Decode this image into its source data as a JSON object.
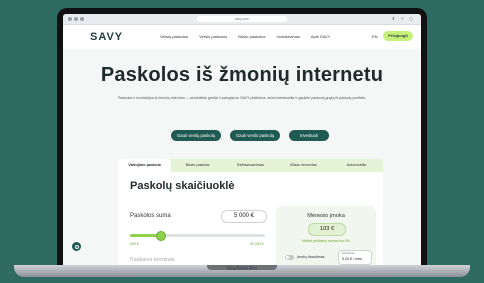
{
  "browser": {
    "url": "savy.com"
  },
  "nav": {
    "logo": "SAVY",
    "links": [
      "Verslų paskolos",
      "Verslo paskolos",
      "Būsto paskolos",
      "Investavimas",
      "Apie SAVY"
    ],
    "lang": "EN",
    "signin": "Prisijungti"
  },
  "hero": {
    "title": "Paskolos iš žmonių internetu",
    "subtitle": "Paskolos ir investicijos iš žmonių internetu — skolinkitės greitai ir patogiai su SAVY platforma, arba investuokite ir gaukite pastovią grąžą iš paskolų portfelio."
  },
  "cta": [
    "Gauti verslų paskolą",
    "Gauti verslo paskolą",
    "Investuoti"
  ],
  "tabs": [
    "Vartojimo paskola",
    "Būsto paskola",
    "Refinansavimas",
    "Būsto remontas",
    "Automobilis"
  ],
  "calculator": {
    "title": "Paskolų skaičiuoklė",
    "loan_label": "Paskolos suma",
    "loan_amount": "5 000 €",
    "slider_fraction": 0.22,
    "min": "500 €",
    "max": "30 000 €",
    "next_label": "Paskolos terminas"
  },
  "monthly": {
    "title": "Mėnesio įmoka",
    "value": "103 €",
    "note": "Metinė palūkanų norma nuo 9%",
    "insurance_label": "Įmokų draudimas",
    "insurance_small": "Draudimas",
    "insurance_value": "5,20 € / mėn."
  },
  "laptop": {
    "label": "MacBook Pro"
  }
}
